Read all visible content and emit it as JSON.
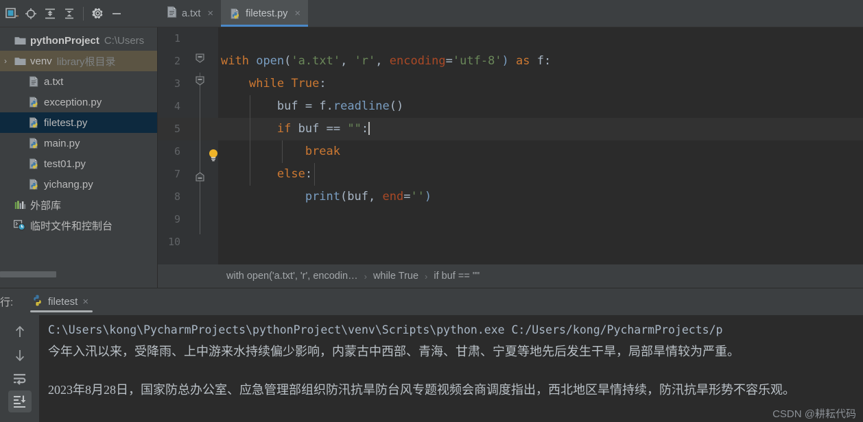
{
  "toolbar": {
    "buttons": [
      {
        "name": "project-view-icon",
        "title": "Project"
      },
      {
        "name": "locate-target-icon",
        "title": "Select Opened File"
      },
      {
        "name": "expand-all-icon",
        "title": "Expand All"
      },
      {
        "name": "collapse-all-icon",
        "title": "Collapse All"
      },
      {
        "name": "settings-gear-icon",
        "title": "Settings"
      },
      {
        "name": "minimize-icon",
        "title": "Hide"
      }
    ]
  },
  "tabs": [
    {
      "label": "a.txt",
      "icon": "text-file-icon",
      "active": false,
      "close": "×"
    },
    {
      "label": "filetest.py",
      "icon": "python-file-icon",
      "active": true,
      "close": "×"
    }
  ],
  "project": {
    "root": {
      "label": "pythonProject",
      "path": "C:\\Users",
      "icon": "folder-icon"
    },
    "items": [
      {
        "label": "venv",
        "sub": "library根目录",
        "icon": "folder-icon",
        "arrow": "›",
        "state": "highlighted"
      },
      {
        "label": "a.txt",
        "sub": "",
        "icon": "text-file-icon",
        "arrow": "",
        "state": "normal"
      },
      {
        "label": "exception.py",
        "sub": "",
        "icon": "python-file-icon",
        "arrow": "",
        "state": "normal"
      },
      {
        "label": "filetest.py",
        "sub": "",
        "icon": "python-file-icon",
        "arrow": "",
        "state": "selected"
      },
      {
        "label": "main.py",
        "sub": "",
        "icon": "python-file-icon",
        "arrow": "",
        "state": "normal"
      },
      {
        "label": "test01.py",
        "sub": "",
        "icon": "python-file-icon",
        "arrow": "",
        "state": "normal"
      },
      {
        "label": "yichang.py",
        "sub": "",
        "icon": "python-file-icon",
        "arrow": "",
        "state": "normal"
      },
      {
        "label": "外部库",
        "sub": "",
        "icon": "external-libraries-icon",
        "arrow": "",
        "state": "normal"
      },
      {
        "label": "临时文件和控制台",
        "sub": "",
        "icon": "scratches-consoles-icon",
        "arrow": "",
        "state": "normal"
      }
    ]
  },
  "editor": {
    "line_numbers": [
      "1",
      "2",
      "3",
      "4",
      "5",
      "6",
      "7",
      "8",
      "9",
      "10"
    ],
    "current_line": 5,
    "gutter_icons": [
      "fold-collapse-icon",
      "fold-collapse-icon",
      "intention-bulb-icon",
      "fold-end-icon"
    ],
    "code": {
      "l1": "",
      "l2": {
        "kw_with": "with",
        "fn_open": "open",
        "p1": "(",
        "s_file": "'a.txt'",
        "c1": ", ",
        "s_mode": "'r'",
        "c2": ", ",
        "kwarg": "encoding",
        "eq": "=",
        "s_enc": "'utf-8'",
        "p2": ")",
        "kw_as": "as",
        "var_f": "f",
        "colon": ":"
      },
      "l3": {
        "kw_while": "while",
        "kw_true": "True",
        "colon": ":"
      },
      "l4": {
        "var_buf": "buf",
        "eq": "=",
        "var_f": "f",
        "dot": ".",
        "fn": "readline",
        "parens": "()"
      },
      "l5": {
        "kw_if": "if",
        "var_buf": "buf",
        "op": "==",
        "str": "\"\"",
        "colon": ":"
      },
      "l6": {
        "kw_break": "break"
      },
      "l7": {
        "kw_else": "else",
        "colon": ":"
      },
      "l8": {
        "fn_print": "print",
        "p1": "(",
        "var_buf": "buf",
        "c1": ", ",
        "kwarg": "end",
        "eq": "=",
        "str": "''",
        "p2": ")"
      },
      "l9": "",
      "l10": ""
    }
  },
  "breadcrumbs": {
    "items": [
      "with open('a.txt', 'r', encodin…",
      "while True",
      "if buf == \"\""
    ],
    "separator": "›"
  },
  "run": {
    "title": "行:",
    "tab_label": "filetest",
    "tab_icon": "python-file-icon",
    "tab_close": "×",
    "side_buttons": [
      {
        "name": "scroll-up-icon",
        "active": false
      },
      {
        "name": "scroll-down-icon",
        "active": false
      },
      {
        "name": "soft-wrap-icon",
        "active": false
      },
      {
        "name": "scroll-to-end-icon",
        "active": true
      }
    ],
    "console": {
      "command": "C:\\Users\\kong\\PycharmProjects\\pythonProject\\venv\\Scripts\\python.exe C:/Users/kong/PycharmProjects/p",
      "line1": "今年入汛以来，受降雨、上中游来水持续偏少影响，内蒙古中西部、青海、甘肃、宁夏等地先后发生干旱，局部旱情较为严重。",
      "line2": "2023年8月28日，国家防总办公室、应急管理部组织防汛抗旱防台风专题视频会商调度指出，西北地区旱情持续，防汛抗旱形势不容乐观。"
    }
  },
  "watermark": "CSDN @耕耘代码",
  "colors": {
    "accent_blue": "#4a88c7",
    "selection_blue": "#0d293e",
    "highlight_tan": "#5b5443",
    "editor_bg": "#2b2b2b",
    "panel_bg": "#3c3f41",
    "keyword_orange": "#cc7832",
    "string_green": "#6a8759",
    "function_blue": "#7a9ec2",
    "kwarg_rust": "#aa4926",
    "text_grey": "#a9b7c6"
  }
}
